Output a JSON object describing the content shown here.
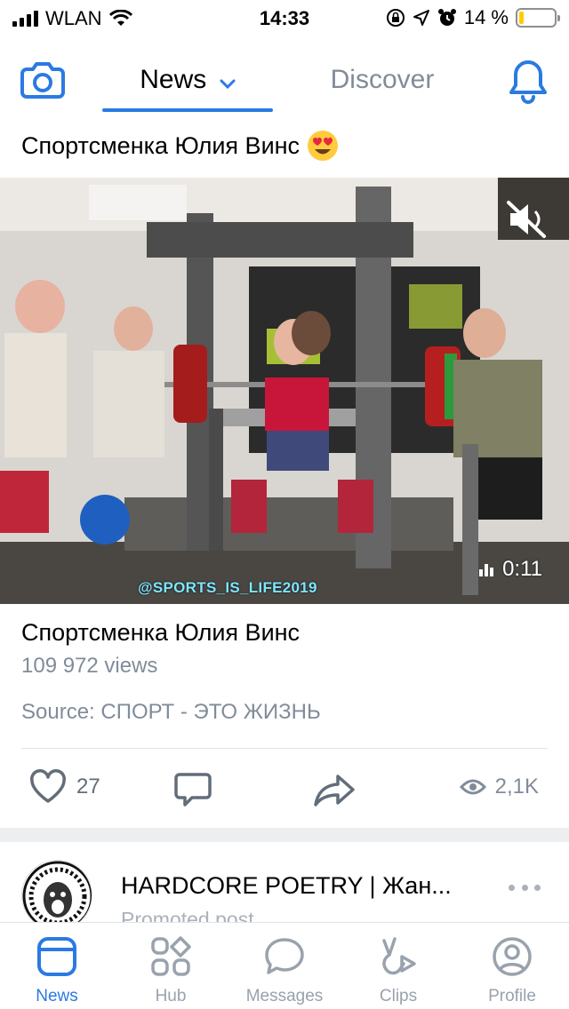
{
  "status_bar": {
    "carrier": "WLAN",
    "time": "14:33",
    "battery_percent": "14 %",
    "battery_level": 0.14,
    "battery_color": "#ffcc00"
  },
  "top_nav": {
    "tabs": [
      {
        "label": "News",
        "active": true
      },
      {
        "label": "Discover",
        "active": false
      }
    ],
    "accent_color": "#2a7ae2"
  },
  "post": {
    "headline": "Спортсменка Юлия Винс",
    "headline_emoji": "heart-eyes",
    "video": {
      "watermark": "@SPORTS_IS_LIFE2019",
      "duration": "0:11",
      "muted": true
    },
    "title": "Спортсменка Юлия Винс",
    "views": "109 972 views",
    "source": "Source: СПОРТ - ЭТО ЖИЗНЬ",
    "likes": "27",
    "view_count": "2,1K"
  },
  "next_post": {
    "author": "HARDCORE POETRY | Жан...",
    "subtitle": "Promoted post"
  },
  "tab_bar": {
    "items": [
      {
        "label": "News",
        "icon": "news-icon",
        "active": true
      },
      {
        "label": "Hub",
        "icon": "hub-icon",
        "active": false
      },
      {
        "label": "Messages",
        "icon": "messages-icon",
        "active": false
      },
      {
        "label": "Clips",
        "icon": "clips-icon",
        "active": false
      },
      {
        "label": "Profile",
        "icon": "profile-icon",
        "active": false
      }
    ]
  }
}
